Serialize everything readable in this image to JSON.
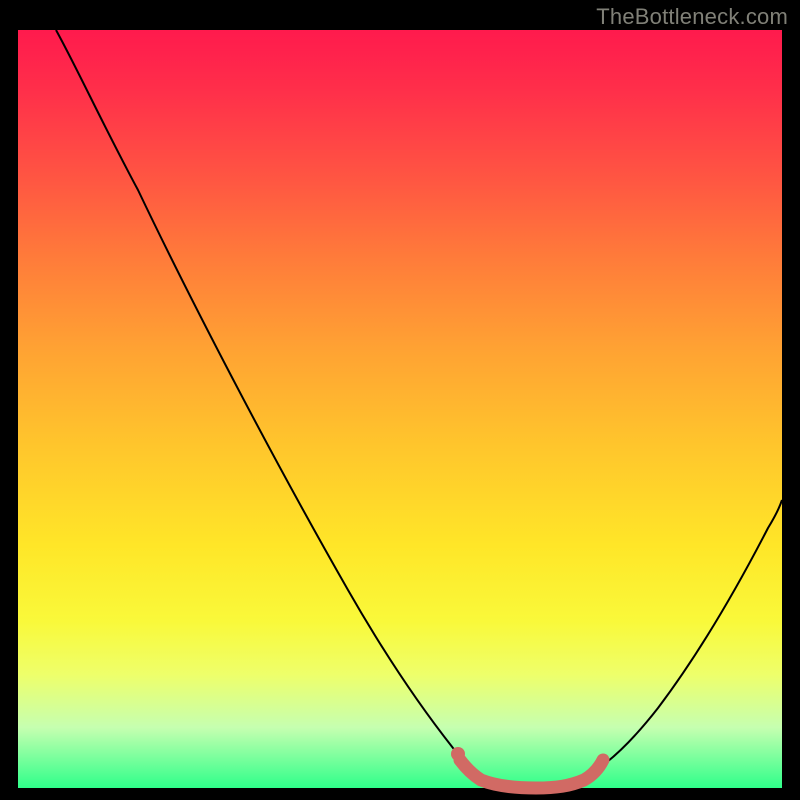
{
  "watermark": "TheBottleneck.com",
  "colors": {
    "gradient_top": "#ff1a4d",
    "gradient_mid": "#ffc62c",
    "gradient_bottom": "#2fff8a",
    "curve": "#000000",
    "marker": "#d16a64",
    "frame": "#000000"
  },
  "chart_data": {
    "type": "line",
    "title": "",
    "xlabel": "",
    "ylabel": "",
    "xlim": [
      0,
      100
    ],
    "ylim": [
      0,
      100
    ],
    "grid": false,
    "legend": false,
    "x": [
      0,
      5,
      10,
      15,
      20,
      25,
      30,
      35,
      40,
      45,
      50,
      55,
      58,
      60,
      62,
      65,
      68,
      70,
      72,
      75,
      80,
      85,
      90,
      95,
      100
    ],
    "series": [
      {
        "name": "bottleneck-curve",
        "values": [
          100,
          90,
          80,
          70,
          61,
          52,
          43,
          35,
          27,
          20,
          13,
          7,
          4,
          2,
          1,
          0,
          0,
          0,
          1,
          3,
          9,
          18,
          28,
          39,
          51
        ]
      }
    ],
    "annotations": {
      "highlight_range_x": [
        57,
        75
      ],
      "highlight_description": "flat bottom region marked with thick salmon line"
    }
  }
}
